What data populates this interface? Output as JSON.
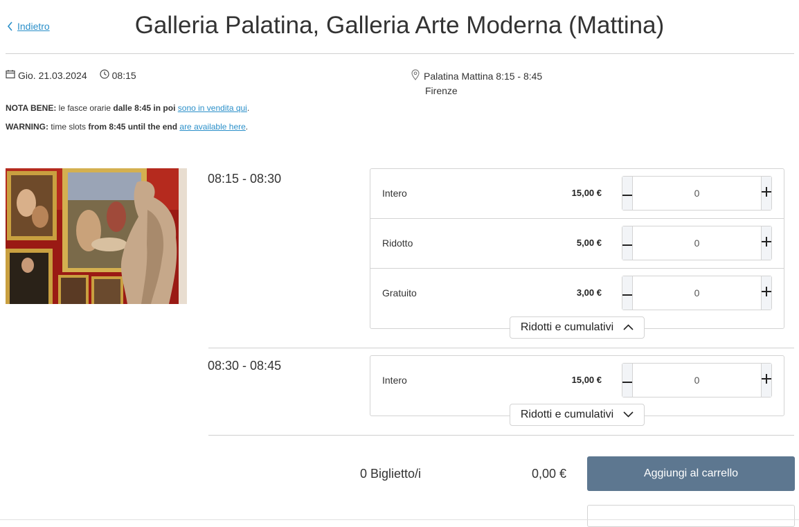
{
  "header": {
    "back_label": "Indietro",
    "title": "Galleria Palatina, Galleria Arte Moderna (Mattina)"
  },
  "event": {
    "date": "Gio. 21.03.2024",
    "time": "08:15",
    "venue": "Palatina Mattina 8:15 - 8:45",
    "city": "Firenze"
  },
  "notes": {
    "it_label": "NOTA BENE:",
    "it_text_1": " le fasce orarie ",
    "it_bold": "dalle 8:45 in poi",
    "it_text_2": " ",
    "it_link": "sono in vendita qui",
    "it_end": ".",
    "en_label": "WARNING:",
    "en_text_1": " time slots ",
    "en_bold": "from 8:45 until the end",
    "en_text_2": " ",
    "en_link": "are available here",
    "en_end": "."
  },
  "slots": [
    {
      "time": "08:15 - 08:30",
      "tickets": [
        {
          "name": "Intero",
          "price": "15,00 €",
          "qty": "0"
        },
        {
          "name": "Ridotto",
          "price": "5,00 €",
          "qty": "0"
        },
        {
          "name": "Gratuito",
          "price": "3,00 €",
          "qty": "0"
        }
      ],
      "toggle_label": "Ridotti e cumulativi",
      "toggle_state": "expanded"
    },
    {
      "time": "08:30 - 08:45",
      "tickets": [
        {
          "name": "Intero",
          "price": "15,00 €",
          "qty": "0"
        }
      ],
      "toggle_label": "Ridotti e cumulativi",
      "toggle_state": "collapsed"
    }
  ],
  "footer": {
    "ticket_count": "0 Biglietto/i",
    "total": "0,00 €",
    "add_to_cart_label": "Aggiungi al carrello"
  },
  "colors": {
    "link": "#2a8fc9",
    "cart_button": "#5d7790",
    "stepper_bg": "#f2f4f7",
    "border": "#d3d3d3"
  },
  "icons": {
    "back": "chevron-left-icon",
    "date": "calendar-icon",
    "time": "clock-icon",
    "location": "map-pin-icon",
    "minus": "minus-icon",
    "plus": "plus-icon",
    "expand": "chevron-up-icon",
    "collapse": "chevron-down-icon"
  }
}
